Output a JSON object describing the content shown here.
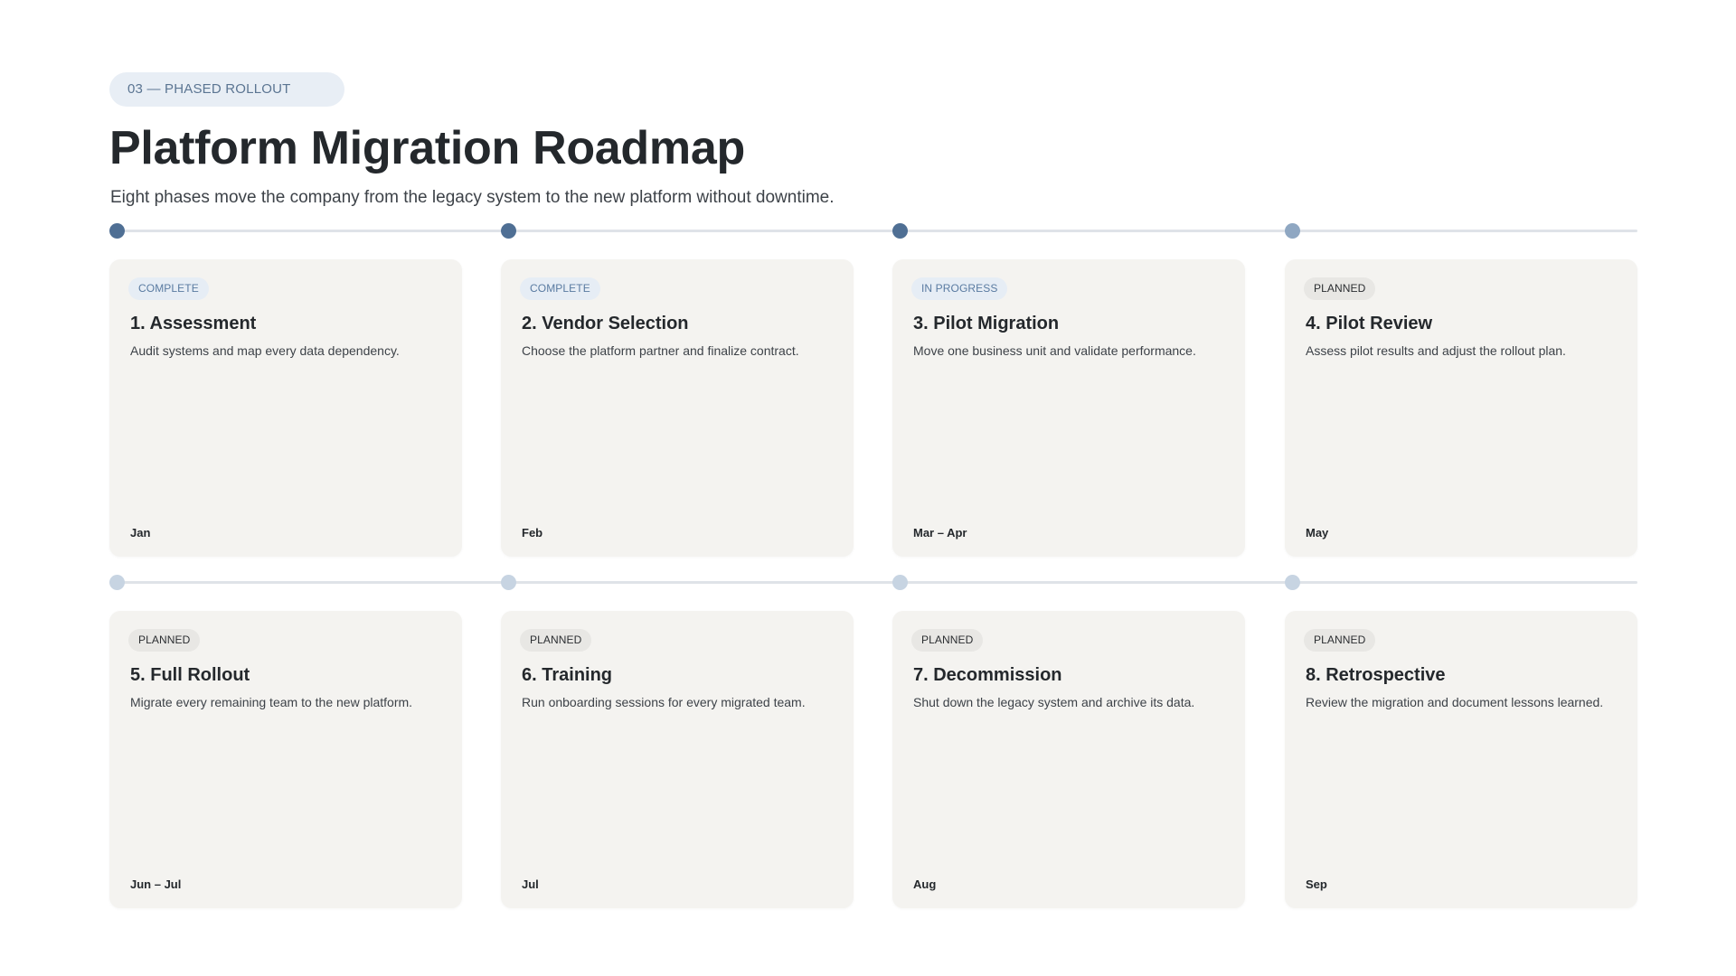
{
  "header": {
    "eyebrow": "03 — PHASED ROLLOUT",
    "title": "Platform Migration Roadmap",
    "subtitle": "Eight phases move the company from the legacy system to the new platform without downtime."
  },
  "colors": {
    "accent": "#4f6f94",
    "complete_badge_text": "#5a7ba1",
    "card_background": "#f4f3f0",
    "track": "#dfe3e8"
  },
  "phases": [
    {
      "status": "COMPLETE",
      "title": "1. Assessment",
      "description": "Audit systems and map every data dependency.",
      "date": "Jan"
    },
    {
      "status": "COMPLETE",
      "title": "2. Vendor Selection",
      "description": "Choose the platform partner and finalize contract.",
      "date": "Feb"
    },
    {
      "status": "IN PROGRESS",
      "title": "3. Pilot Migration",
      "description": "Move one business unit and validate performance.",
      "date": "Mar – Apr"
    },
    {
      "status": "PLANNED",
      "title": "4. Pilot Review",
      "description": "Assess pilot results and adjust the rollout plan.",
      "date": "May"
    },
    {
      "status": "PLANNED",
      "title": "5. Full Rollout",
      "description": "Migrate every remaining team to the new platform.",
      "date": "Jun – Jul"
    },
    {
      "status": "PLANNED",
      "title": "6. Training",
      "description": "Run onboarding sessions for every migrated team.",
      "date": "Jul"
    },
    {
      "status": "PLANNED",
      "title": "7. Decommission",
      "description": "Shut down the legacy system and archive its data.",
      "date": "Aug"
    },
    {
      "status": "PLANNED",
      "title": "8. Retrospective",
      "description": "Review the migration and document lessons learned.",
      "date": "Sep"
    }
  ]
}
